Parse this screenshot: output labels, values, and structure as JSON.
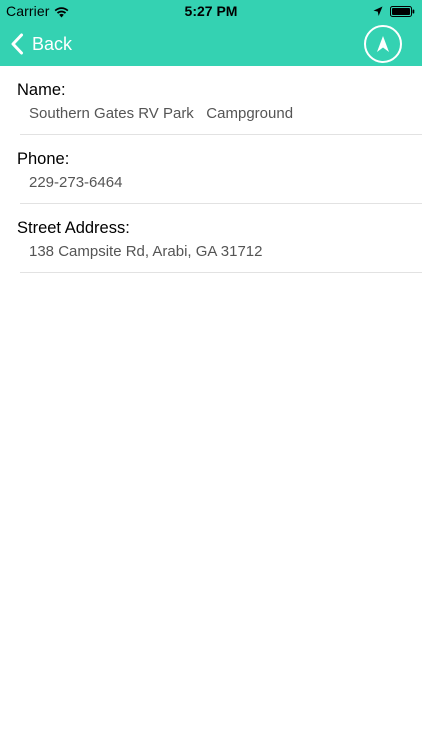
{
  "status_bar": {
    "carrier": "Carrier",
    "time": "5:27 PM",
    "icons": [
      "wifi-icon",
      "location-arrow-icon",
      "battery-icon"
    ]
  },
  "nav": {
    "back_label": "Back",
    "back_icon": "chevron-left-icon",
    "action_icon": "navigate-icon",
    "bar_color": "#34d2b2"
  },
  "details": {
    "name_label": "Name:",
    "name_value": "Southern Gates RV Park   Campground",
    "phone_label": "Phone:",
    "phone_value": "229-273-6464",
    "address_label": "Street Address:",
    "address_value": "138 Campsite Rd, Arabi, GA 31712"
  }
}
